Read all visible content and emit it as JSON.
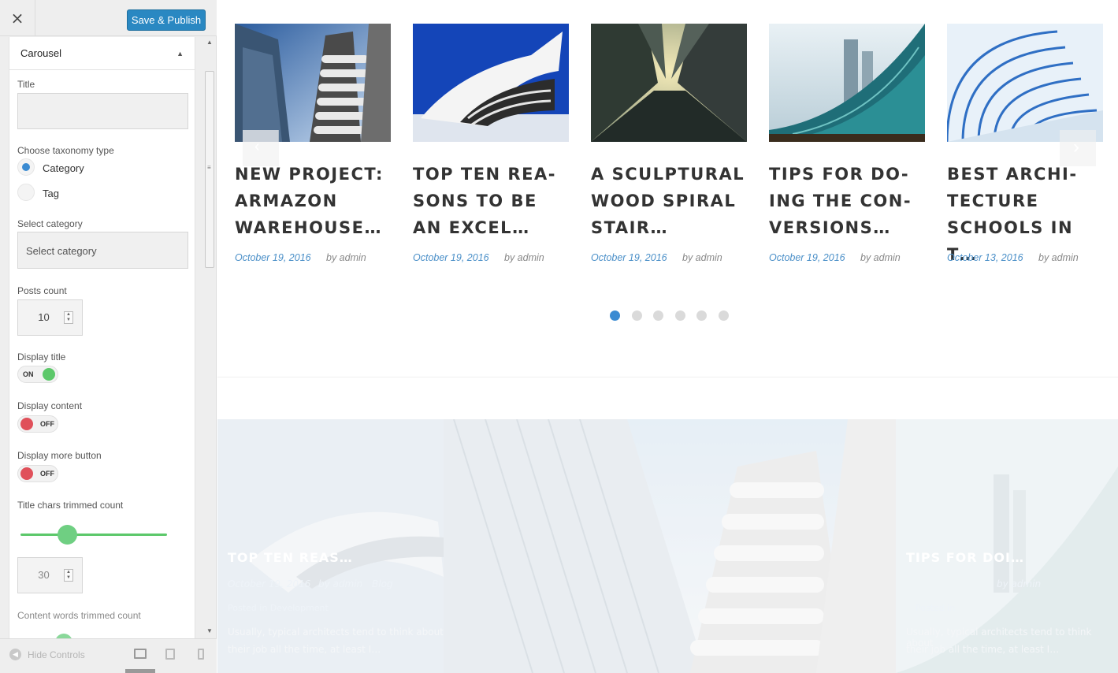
{
  "sidebar": {
    "close_icon": "×",
    "publish_label": "Save & Publish",
    "section_title": "Carousel",
    "fields": {
      "title_label": "Title",
      "taxonomy_label": "Choose taxonomy type",
      "taxonomy_options": [
        "Category",
        "Tag"
      ],
      "taxonomy_selected": "Category",
      "select_category_label": "Select category",
      "select_category_value": "Select category",
      "posts_count_label": "Posts count",
      "posts_count_value": "10",
      "display_title_label": "Display title",
      "display_title_state": "ON",
      "display_content_label": "Display content",
      "display_content_state": "OFF",
      "display_more_label": "Display more button",
      "display_more_state": "OFF",
      "title_chars_label": "Title chars trimmed count",
      "title_chars_value": "30",
      "title_chars_slider_fraction": 0.32,
      "content_words_label": "Content words trimmed count"
    },
    "footer": {
      "hide_controls_label": "Hide Controls",
      "devices": [
        "desktop-icon",
        "tablet-icon",
        "mobile-icon"
      ]
    }
  },
  "carousel": {
    "posts": [
      {
        "title": "NEW PROJECT: ARMAZON WAREHOUSE…",
        "date": "October 19, 2016",
        "author": "by admin"
      },
      {
        "title": "TOP TEN REA-SONS TO BE AN EXCEL…",
        "date": "October 19, 2016",
        "author": "by admin"
      },
      {
        "title": "A SCULPTURAL WOOD SPIRAL STAIR…",
        "date": "October 19, 2016",
        "author": "by admin"
      },
      {
        "title": "TIPS FOR DO-ING THE CON-VERSIONS…",
        "date": "October 19, 2016",
        "author": "by admin"
      },
      {
        "title": "BEST ARCHI-TECTURE SCHOOLS IN T…",
        "date": "October 13, 2016",
        "author": "by admin"
      }
    ],
    "pagination_count": 6,
    "pagination_active": 1
  },
  "lower": {
    "left_title": "TOP TEN REAS…",
    "left_date": "October 19, 2016",
    "left_author": "by admin",
    "left_category": "Blog",
    "left_posted_in": "Posted in Development",
    "left_excerpt_1": "Usually, typical architects tend to think about",
    "left_excerpt_2": "their job all the time, at least I…",
    "right_title": "TIPS FOR DOI…",
    "right_author": "by admin",
    "right_posted_in": "Posted in",
    "right_excerpt_1": "Usually, typical architects tend to think about",
    "right_excerpt_2": "their job all the time, at least I…"
  },
  "colors": {
    "accent": "#2a88c2",
    "link": "#4a8fc8",
    "on": "#5cc86a",
    "off": "#e0505a"
  }
}
